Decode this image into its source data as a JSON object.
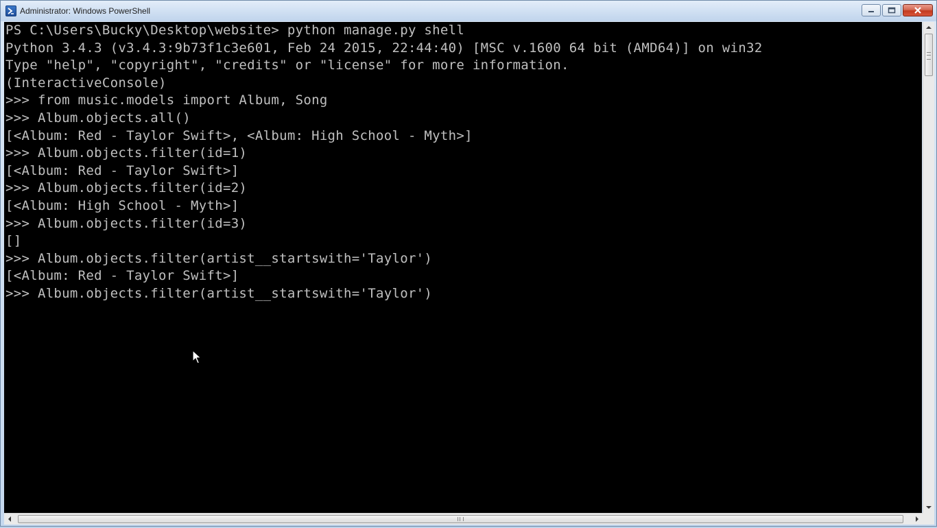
{
  "window": {
    "title": "Administrator: Windows PowerShell",
    "icon": "powershell-icon"
  },
  "caption_buttons": {
    "minimize_icon": "minimize-icon",
    "maximize_icon": "maximize-icon",
    "close_icon": "close-icon"
  },
  "console": {
    "background": "#000000",
    "foreground": "#c0c0c0",
    "lines": [
      "PS C:\\Users\\Bucky\\Desktop\\website> python manage.py shell",
      "Python 3.4.3 (v3.4.3:9b73f1c3e601, Feb 24 2015, 22:44:40) [MSC v.1600 64 bit (AMD64)] on win32",
      "Type \"help\", \"copyright\", \"credits\" or \"license\" for more information.",
      "(InteractiveConsole)",
      ">>> from music.models import Album, Song",
      ">>> Album.objects.all()",
      "[<Album: Red - Taylor Swift>, <Album: High School - Myth>]",
      ">>> Album.objects.filter(id=1)",
      "[<Album: Red - Taylor Swift>]",
      ">>> Album.objects.filter(id=2)",
      "[<Album: High School - Myth>]",
      ">>> Album.objects.filter(id=3)",
      "[]",
      ">>> Album.objects.filter(artist__startswith='Taylor')",
      "[<Album: Red - Taylor Swift>]",
      ">>> Album.objects.filter(artist__startswith='Taylor')"
    ]
  },
  "scrollbars": {
    "vertical": {
      "up_icon": "scroll-up-arrow-icon",
      "down_icon": "scroll-down-arrow-icon"
    },
    "horizontal": {
      "left_icon": "scroll-left-arrow-icon",
      "right_icon": "scroll-right-arrow-icon"
    }
  },
  "pointer": {
    "icon": "mouse-pointer-icon"
  }
}
